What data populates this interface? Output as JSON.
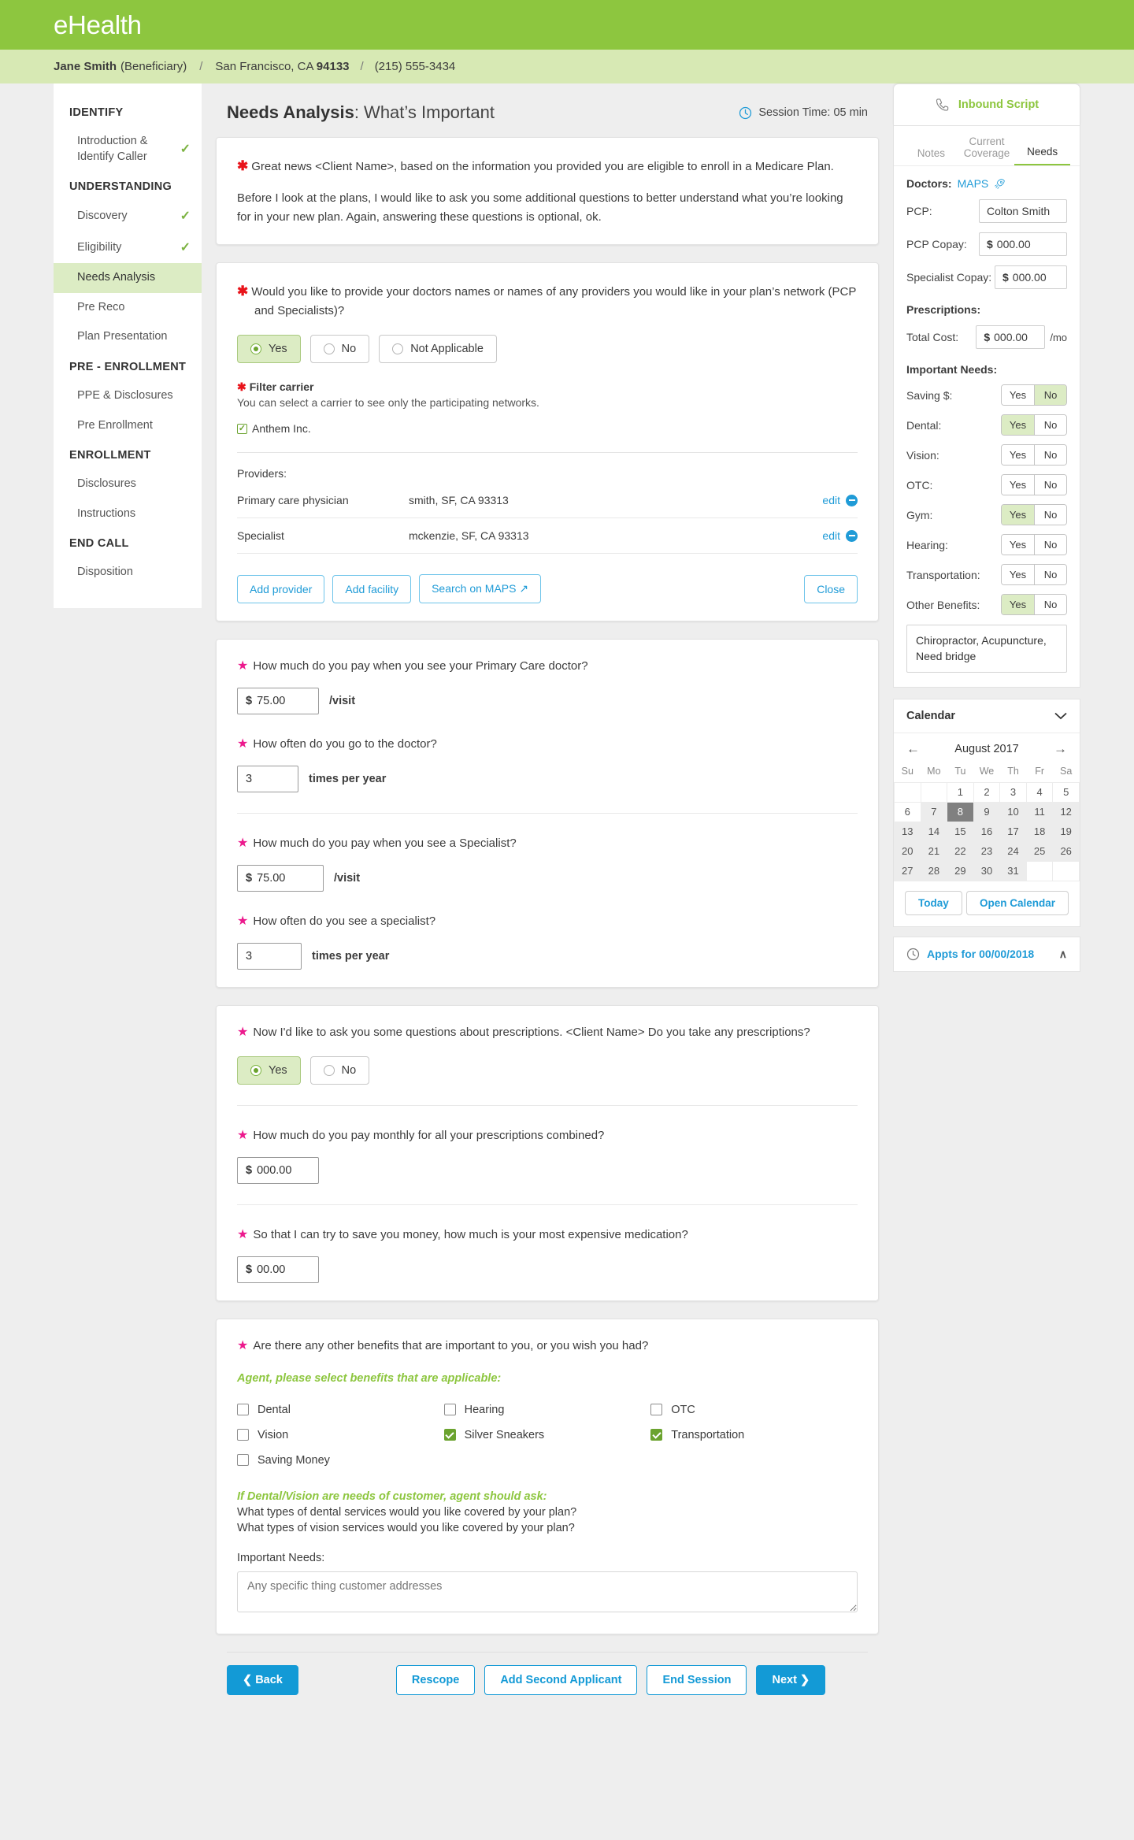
{
  "brand": {
    "name": "eHealth",
    "green": "#8dc63f",
    "blue": "#139ad6",
    "pink": "#ec1a8d",
    "red": "#e8131a"
  },
  "subbar": {
    "client_name": "Jane Smith",
    "client_role": "(Beneficiary)",
    "sep": "/",
    "location_city": "San Francisco, CA ",
    "location_zip": "94133",
    "phone": "(215) 555-3434"
  },
  "sidebar": {
    "groups": [
      {
        "label": "IDENTIFY",
        "items": [
          {
            "label": "Introduction & Identify Caller",
            "check": "✓",
            "active": false
          }
        ]
      },
      {
        "label": "UNDERSTANDING",
        "items": [
          {
            "label": "Discovery",
            "check": "✓",
            "active": false
          },
          {
            "label": "Eligibility",
            "check": "✓",
            "active": false
          },
          {
            "label": "Needs Analysis",
            "check": "",
            "active": true
          },
          {
            "label": "Pre Reco",
            "check": "",
            "active": false
          },
          {
            "label": "Plan Presentation",
            "check": "",
            "active": false
          }
        ]
      },
      {
        "label": "PRE - ENROLLMENT",
        "items": [
          {
            "label": "PPE & Disclosures",
            "check": "",
            "active": false
          },
          {
            "label": "Pre Enrollment",
            "check": "",
            "active": false
          }
        ]
      },
      {
        "label": "ENROLLMENT",
        "items": [
          {
            "label": "Disclosures",
            "check": "",
            "active": false
          },
          {
            "label": "Instructions",
            "check": "",
            "active": false
          }
        ]
      },
      {
        "label": "END CALL",
        "items": [
          {
            "label": "Disposition",
            "check": "",
            "active": false
          }
        ]
      }
    ]
  },
  "main": {
    "title_bold": "Needs Analysis",
    "title_rest": ": What’s Important",
    "session_label": "Session Time: 05 min",
    "intro": {
      "para1": "Great news <Client Name>, based on the information you provided you are eligible to enroll in a Medicare Plan.",
      "para2": "Before I look at the plans, I would like to ask you some additional questions to better understand what you’re looking for in your new plan.  Again, answering these questions is optional, ok."
    },
    "providers_card": {
      "question": "Would you like to provide your doctors names or names of any providers you would like in your plan’s network (PCP and Specialists)?",
      "options": [
        {
          "label": "Yes",
          "selected": true
        },
        {
          "label": "No",
          "selected": false
        },
        {
          "label": "Not Applicable",
          "selected": false
        }
      ],
      "filter_label": "Filter carrier",
      "filter_sub": "You can select a carrier to see only the participating networks.",
      "carrier": {
        "label": "Anthem Inc.",
        "checked": true
      },
      "providers_label": "Providers:",
      "rows": [
        {
          "type": "Primary care physician",
          "value": "smith, SF, CA 93313",
          "edit": "edit"
        },
        {
          "type": "Specialist",
          "value": "mckenzie, SF, CA 93313",
          "edit": "edit"
        }
      ],
      "buttons": {
        "add_provider": "Add provider",
        "add_facility": "Add facility",
        "search_maps": "Search on MAPS",
        "close": "Close"
      }
    },
    "costs_card": {
      "q1": "How much do you pay when you see your Primary Care doctor?",
      "a1_currency": "$",
      "a1_value": "75.00",
      "a1_unit": "/visit",
      "q2": "How often do you go to the doctor?",
      "a2_value": "3",
      "a2_unit": "times per year",
      "q3": "How much do you pay when you see a Specialist?",
      "a3_currency": "$",
      "a3_value": "75.00",
      "a3_unit": "/visit",
      "q4": "How often do you see a specialist?",
      "a4_value": "3",
      "a4_unit": "times per year"
    },
    "rx_card": {
      "q1": "Now I'd like to ask you some questions about prescriptions. <Client Name> Do you take any prescriptions?",
      "options": [
        {
          "label": "Yes",
          "selected": true
        },
        {
          "label": "No",
          "selected": false
        }
      ],
      "q2": "How much do you pay monthly for all your prescriptions combined?",
      "a2_currency": "$",
      "a2_value": "000.00",
      "q3": "So that I can try to save you money, how much is your most expensive medication?",
      "a3_currency": "$",
      "a3_value": "00.00"
    },
    "benefits_card": {
      "question": "Are there any other benefits that are important to you, or you wish you had?",
      "agent_note": "Agent, please select benefits that are applicable:",
      "checkboxes": [
        {
          "label": "Dental",
          "checked": false
        },
        {
          "label": "Hearing",
          "checked": false
        },
        {
          "label": "OTC",
          "checked": false
        },
        {
          "label": "Vision",
          "checked": false
        },
        {
          "label": "Silver Sneakers",
          "checked": true
        },
        {
          "label": "Transportation",
          "checked": true
        },
        {
          "label": "Saving Money",
          "checked": false
        }
      ],
      "ask_note": "If Dental/Vision are needs of customer, agent should ask:",
      "ask_lines": [
        "What types of dental services would you like covered by your plan?",
        "What types of vision services would you like covered by your plan?"
      ],
      "needs_label": "Important Needs:",
      "needs_placeholder": "Any specific thing customer addresses",
      "needs_value": ""
    }
  },
  "rail": {
    "script_tab": "Inbound Script",
    "tabs": [
      {
        "label": "Notes",
        "active": false
      },
      {
        "label": "Current Coverage",
        "active": false
      },
      {
        "label": "Needs",
        "active": true
      }
    ],
    "doctors_label": "Doctors:",
    "maps_link": "MAPS",
    "fields": [
      {
        "label": "PCP:",
        "currency": "",
        "value": "Colton Smith"
      },
      {
        "label": "PCP Copay:",
        "currency": "$",
        "value": "000.00"
      },
      {
        "label": "Specialist Copay:",
        "currency": "$",
        "value": "000.00"
      }
    ],
    "prescriptions_label": "Prescriptions:",
    "total_cost": {
      "label": "Total Cost:",
      "currency": "$",
      "value": "000.00",
      "suffix": "/mo"
    },
    "important_needs_label": "Important Needs:",
    "toggles": [
      {
        "label": "Saving $:",
        "yes": "Yes",
        "no": "No",
        "value": "No"
      },
      {
        "label": "Dental:",
        "yes": "Yes",
        "no": "No",
        "value": "Yes"
      },
      {
        "label": "Vision:",
        "yes": "Yes",
        "no": "No",
        "value": ""
      },
      {
        "label": "OTC:",
        "yes": "Yes",
        "no": "No",
        "value": ""
      },
      {
        "label": "Gym:",
        "yes": "Yes",
        "no": "No",
        "value": "Yes"
      },
      {
        "label": "Hearing:",
        "yes": "Yes",
        "no": "No",
        "value": ""
      },
      {
        "label": "Transportation:",
        "yes": "Yes",
        "no": "No",
        "value": ""
      },
      {
        "label": "Other Benefits:",
        "yes": "Yes",
        "no": "No",
        "value": "Yes"
      }
    ],
    "other_benefits_text": "Chiropractor, Acupuncture, Need bridge",
    "calendar": {
      "title": "Calendar",
      "month": "August 2017",
      "prev": "←",
      "next": "→",
      "daynames": [
        "Su",
        "Mo",
        "Tu",
        "We",
        "Th",
        "Fr",
        "Sa"
      ],
      "weeks": [
        [
          "",
          "",
          "1",
          "2",
          "3",
          "4",
          "5"
        ],
        [
          "6",
          "7",
          "8",
          "9",
          "10",
          "11",
          "12"
        ],
        [
          "13",
          "14",
          "15",
          "16",
          "17",
          "18",
          "19"
        ],
        [
          "20",
          "21",
          "22",
          "23",
          "24",
          "25",
          "26"
        ],
        [
          "27",
          "28",
          "29",
          "30",
          "31",
          "",
          ""
        ]
      ],
      "today_cell": "8",
      "today_btn": "Today",
      "open_btn": "Open Calendar"
    },
    "appts": {
      "label": "Appts for 00/00/2018",
      "caret": "∧"
    }
  },
  "footer": {
    "back": "Back",
    "rescope": "Rescope",
    "add_second_applicant": "Add Second Applicant",
    "end_session": "End Session",
    "next": "Next"
  }
}
